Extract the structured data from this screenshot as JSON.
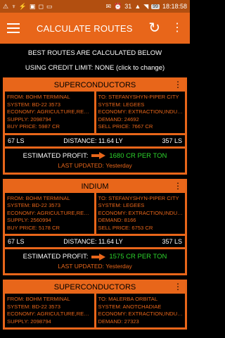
{
  "statusbar": {
    "left_icons": [
      "⚠",
      "♆",
      "⚡",
      "▣",
      "◻",
      "▭"
    ],
    "right_icons": [
      "✉",
      "⏰",
      "31",
      "▲",
      "◥"
    ],
    "battery": "99",
    "time": "18:18:58"
  },
  "appbar": {
    "title": "CALCULATE ROUTES"
  },
  "info": {
    "line1": "BEST ROUTES ARE CALCULATED BELOW",
    "line2": "USING CREDIT LIMIT: NONE (click to change)"
  },
  "routes": [
    {
      "commodity": "SUPERCONDUCTORS",
      "from": {
        "station": "FROM: BOHM TERMINAL",
        "system": "SYSTEM: BD-22 3573",
        "economy": "ECONOMY: AGRICULTURE,REFINERY",
        "supply": "SUPPLY: 2098794",
        "price": "BUY PRICE: 5987 CR"
      },
      "to": {
        "station": "TO: STEFANYSHYN-PIPER CITY",
        "system": "SYSTEM: LEGEES",
        "economy": "ECONOMY: EXTRACTION,INDUSTRIAL",
        "demand": "DEMAND: 24692",
        "price": "SELL PRICE: 7667 CR"
      },
      "from_ls": "67 LS",
      "distance": "DISTANCE: 11.64 LY",
      "to_ls": "357 LS",
      "profit_label": "ESTIMATED PROFIT:",
      "profit": "1680 CR PER TON",
      "updated": "LAST UPDATED: Yesterday"
    },
    {
      "commodity": "INDIUM",
      "from": {
        "station": "FROM: BOHM TERMINAL",
        "system": "SYSTEM: BD-22 3573",
        "economy": "ECONOMY: AGRICULTURE,REFINERY",
        "supply": "SUPPLY: 2560994",
        "price": "BUY PRICE: 5178 CR"
      },
      "to": {
        "station": "TO: STEFANYSHYN-PIPER CITY",
        "system": "SYSTEM: LEGEES",
        "economy": "ECONOMY: EXTRACTION,INDUSTRIAL",
        "demand": "DEMAND: 8166",
        "price": "SELL PRICE: 6753 CR"
      },
      "from_ls": "67 LS",
      "distance": "DISTANCE: 11.64 LY",
      "to_ls": "357 LS",
      "profit_label": "ESTIMATED PROFIT:",
      "profit": "1575 CR PER TON",
      "updated": "LAST UPDATED: Yesterday"
    },
    {
      "commodity": "SUPERCONDUCTORS",
      "from": {
        "station": "FROM: BOHM TERMINAL",
        "system": "SYSTEM: BD-22 3573",
        "economy": "ECONOMY: AGRICULTURE,REFINERY",
        "supply": "SUPPLY: 2098794"
      },
      "to": {
        "station": "TO: MALERBA ORBITAL",
        "system": "SYSTEM: ANOTCHADIAE",
        "economy": "ECONOMY: EXTRACTION,INDUSTRIAL",
        "demand": "DEMAND: 27323"
      }
    }
  ]
}
